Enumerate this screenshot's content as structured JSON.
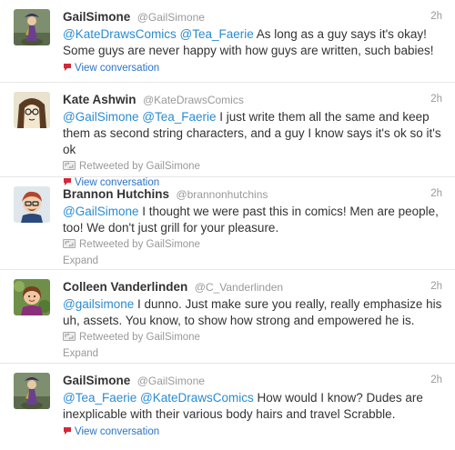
{
  "tweets": [
    {
      "fullname": "GailSimone",
      "username": "@GailSimone",
      "time": "2h",
      "mentions": [
        "@KateDrawsComics",
        "@Tea_Faerie"
      ],
      "text": " As long as a guy says it's okay! Some guys are never happy with how guys are written, such babies!",
      "action": "View conversation"
    },
    {
      "fullname": "Kate Ashwin",
      "username": "@KateDrawsComics",
      "time": "2h",
      "mentions": [
        "@GailSimone",
        "@Tea_Faerie"
      ],
      "text": " I just write them all the same and keep them as second string characters, and a guy I know says it's ok so it's ok",
      "retweeted": "Retweeted by GailSimone",
      "action": "View conversation"
    },
    {
      "fullname": "Brannon Hutchins",
      "username": "@brannonhutchins",
      "time": "2h",
      "mentions": [
        "@GailSimone"
      ],
      "text": " I thought we were past this in comics! Men are people, too! We don't just grill for your pleasure.",
      "retweeted": "Retweeted by GailSimone",
      "action": "Expand"
    },
    {
      "fullname": "Colleen Vanderlinden",
      "username": "@C_Vanderlinden",
      "time": "2h",
      "mentions": [
        "@gailsimone"
      ],
      "text": " I dunno. Just make sure you really, really emphasize his uh, assets. You know, to show how strong and empowered he is.",
      "retweeted": "Retweeted by GailSimone",
      "action": "Expand"
    },
    {
      "fullname": "GailSimone",
      "username": "@GailSimone",
      "time": "2h",
      "mentions": [
        "@Tea_Faerie",
        "@KateDrawsComics"
      ],
      "text": " How would I know? Dudes are inexplicable with their various body hairs and travel Scrabble.",
      "action": "View conversation"
    }
  ],
  "colors": {
    "link": "#2a8bd1",
    "meta": "#999999",
    "text": "#333333",
    "view_conversation_bubble": "#d4283a"
  },
  "icons": {
    "view": "speech-bubble-icon",
    "retweet": "retweet-icon"
  }
}
